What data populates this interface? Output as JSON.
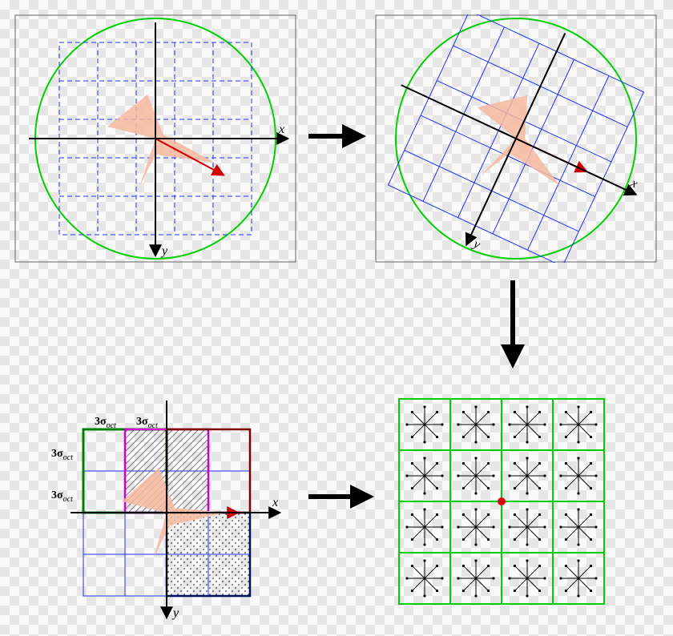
{
  "panels": {
    "top_left": {
      "axis_x_label": "x",
      "axis_y_label": "y",
      "grid_style": "dashed",
      "grid_cells": 5
    },
    "top_right": {
      "axis_x_label": "x",
      "axis_y_label": "y",
      "grid_style": "solid",
      "grid_cells": 5,
      "rotation_deg": 25
    },
    "bottom_left": {
      "axis_x_label": "x",
      "axis_y_label": "y",
      "grid_cells": 4,
      "sigma_labels": {
        "col1": "3σ_oct",
        "col2": "3σ_oct",
        "row1": "3σ_oct",
        "row2": "3σ_oct"
      },
      "highlight_boxes": [
        {
          "name": "green-box",
          "color": "#008000",
          "cells": "r0-1_c0-1"
        },
        {
          "name": "magenta-box",
          "color": "#d000d0",
          "cells": "r0-1_c1-2",
          "fill": "hatch"
        },
        {
          "name": "maroon-box",
          "color": "#800000",
          "cells": "r0-1_c2-3",
          "fill": "hatch"
        },
        {
          "name": "navy-box",
          "color": "#001060",
          "cells": "r2-3_c2-3",
          "fill": "dots"
        }
      ]
    },
    "bottom_right": {
      "grid_cells": 4,
      "orientation_bins_per_cell": 8,
      "keypoint_at_center": true
    }
  },
  "flow_arrows": [
    {
      "from": "top_left",
      "to": "top_right"
    },
    {
      "from": "top_right",
      "to": "bottom_right"
    },
    {
      "from": "bottom_left",
      "to": "bottom_right"
    }
  ]
}
